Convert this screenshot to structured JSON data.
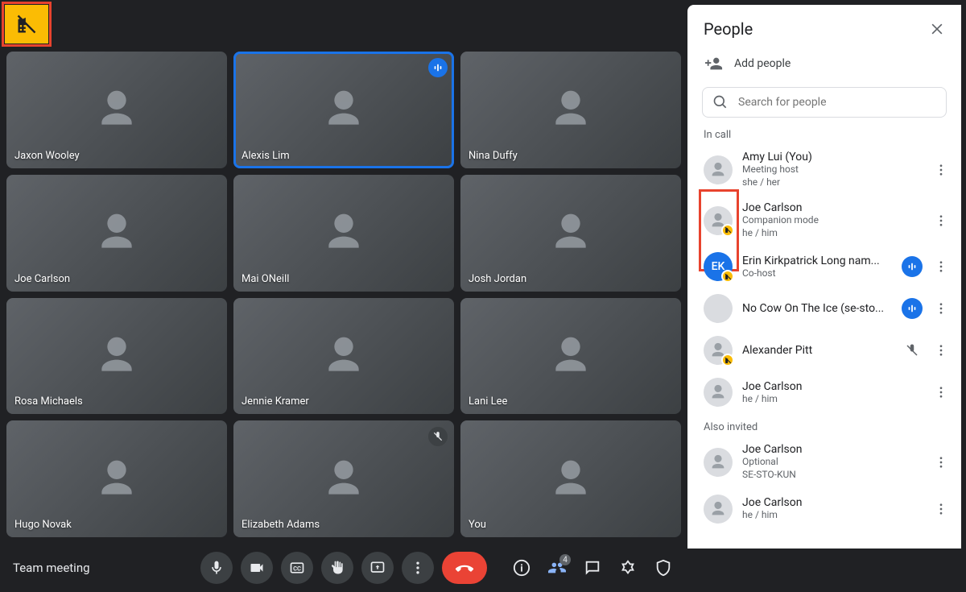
{
  "meeting": {
    "name": "Team meeting"
  },
  "tiles": [
    {
      "name": "Jaxon Wooley"
    },
    {
      "name": "Alexis Lim",
      "speaking": true,
      "audio_badge": true
    },
    {
      "name": "Nina Duffy"
    },
    {
      "name": "Joe Carlson"
    },
    {
      "name": "Mai ONeill"
    },
    {
      "name": "Josh Jordan"
    },
    {
      "name": "Rosa Michaels"
    },
    {
      "name": "Jennie Kramer"
    },
    {
      "name": "Lani Lee"
    },
    {
      "name": "Hugo Novak"
    },
    {
      "name": "Elizabeth Adams",
      "muted": true
    },
    {
      "name": "You"
    }
  ],
  "panel": {
    "title": "People",
    "add_label": "Add people",
    "search_placeholder": "Search for people",
    "section_in_call": "In call",
    "section_also": "Also invited",
    "people_count_badge": "4",
    "in_call": [
      {
        "name": "Amy Lui (You)",
        "sub1": "Meeting host",
        "sub2": "she / her"
      },
      {
        "name": "Joe Carlson",
        "sub1": "Companion mode",
        "sub2": "he / him",
        "companion": true
      },
      {
        "name": "Erin Kirkpatrick Long nam...",
        "sub1": "Co-host",
        "initials": "EK",
        "companion": true,
        "speaking": true
      },
      {
        "name": "No Cow On The Ice (se-sto...",
        "blank": true,
        "speaking": true
      },
      {
        "name": "Alexander Pitt",
        "companion": true,
        "muted": true
      },
      {
        "name": "Joe Carlson",
        "sub1": "he / him"
      }
    ],
    "also_invited": [
      {
        "name": "Joe Carlson",
        "sub1": "Optional",
        "sub2": "SE-STO-KUN"
      },
      {
        "name": "Joe Carlson",
        "sub1": "he / him"
      }
    ]
  },
  "icons": {
    "mic": "mic",
    "cam": "cam",
    "cc": "cc",
    "hand": "hand",
    "present": "present",
    "more": "more",
    "hangup": "hangup",
    "info": "info",
    "people": "people",
    "chat": "chat",
    "activities": "activities",
    "host": "host"
  }
}
